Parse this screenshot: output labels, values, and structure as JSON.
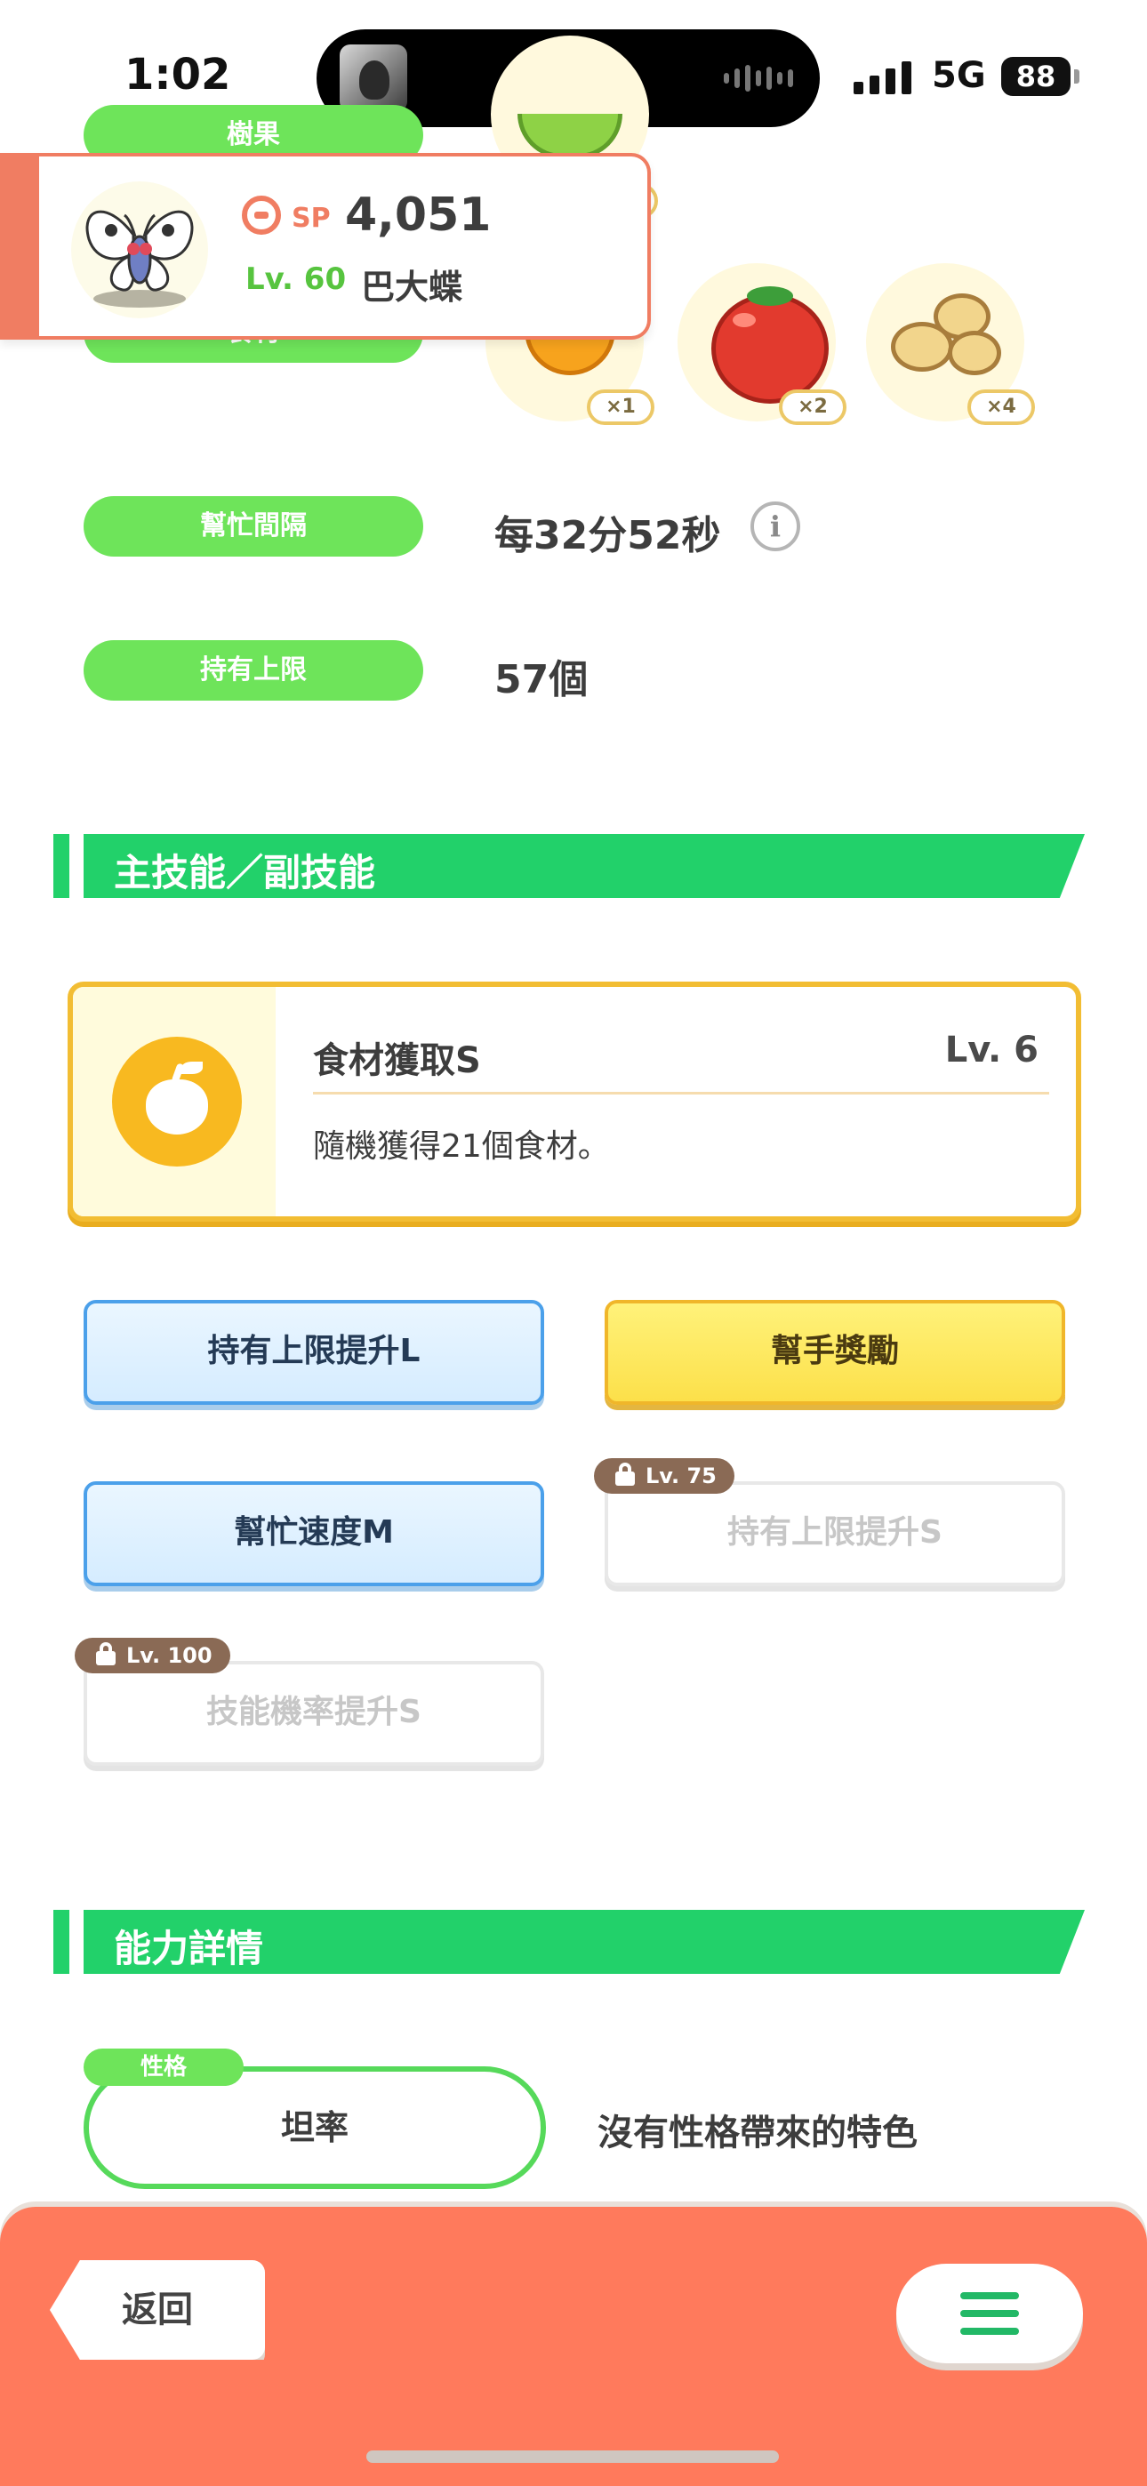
{
  "status_bar": {
    "time": "1:02",
    "network": "5G",
    "battery": "88"
  },
  "pokemon": {
    "sp_label": "SP",
    "sp_value": "4,051",
    "level": "Lv. 60",
    "name": "巴大蝶",
    "accent_color": "#f07d62"
  },
  "fields": {
    "berries_label": "樹果",
    "ingredients_label": "食材",
    "ingredients": [
      {
        "icon": "honey-icon",
        "count": "×1"
      },
      {
        "icon": "tomato-icon",
        "count": "×2"
      },
      {
        "icon": "soybeans-icon",
        "count": "×4"
      }
    ],
    "help_interval_label": "幫忙間隔",
    "help_interval_value": "每32分52秒",
    "carry_limit_label": "持有上限",
    "carry_limit_value": "57個"
  },
  "skills_section": {
    "title": "主技能／副技能",
    "main_skill": {
      "name": "食材獲取S",
      "level": "Lv. 6",
      "description": "隨機獲得21個食材。",
      "icon": "apple-icon"
    },
    "sub_skills": [
      {
        "label": "持有上限提升L",
        "style": "blue",
        "locked": false
      },
      {
        "label": "幫手獎勵",
        "style": "gold",
        "locked": false
      },
      {
        "label": "幫忙速度M",
        "style": "blue",
        "locked": false
      },
      {
        "label": "持有上限提升S",
        "style": "locked",
        "locked": true,
        "unlock_level": "Lv. 75"
      },
      {
        "label": "技能機率提升S",
        "style": "locked",
        "locked": true,
        "unlock_level": "Lv. 100"
      }
    ]
  },
  "ability_section": {
    "title": "能力詳情",
    "nature_tag": "性格",
    "nature_value": "坦率",
    "nature_description": "沒有性格帶來的特色"
  },
  "bottom_bar": {
    "back_label": "返回",
    "menu_icon": "hamburger-menu-icon",
    "color": "#ff7a5c"
  }
}
